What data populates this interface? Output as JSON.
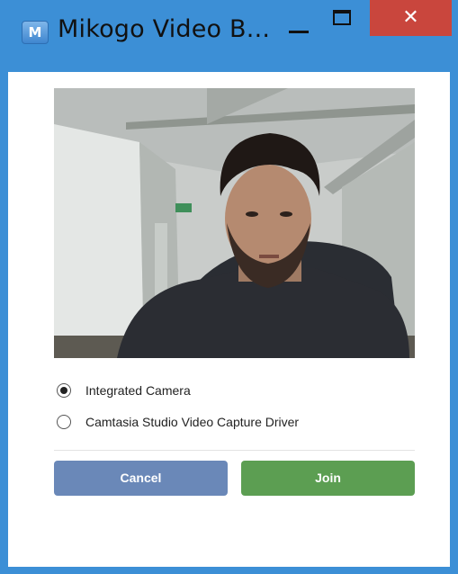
{
  "window": {
    "title": "Mikogo Video B...",
    "app_icon_glyph": "M",
    "minimize_icon": "minimize-icon",
    "maximize_icon": "maximize-icon",
    "close_icon": "close-icon",
    "close_glyph": "✕"
  },
  "camera_options": [
    {
      "label": "Integrated Camera",
      "selected": true
    },
    {
      "label": "Camtasia Studio Video Capture Driver",
      "selected": false
    }
  ],
  "buttons": {
    "cancel_label": "Cancel",
    "join_label": "Join"
  },
  "colors": {
    "window_frame": "#3c8fd6",
    "close_button": "#c9463d",
    "cancel_button": "#6a88b8",
    "join_button": "#5c9e52"
  }
}
